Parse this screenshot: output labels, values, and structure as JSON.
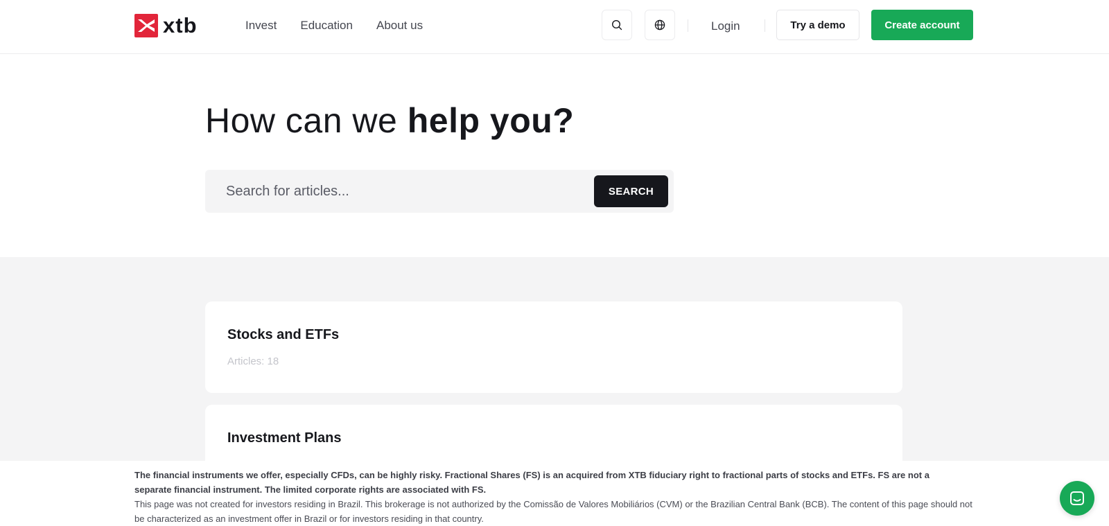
{
  "header": {
    "logo_text": "xtb",
    "nav": [
      {
        "label": "Invest"
      },
      {
        "label": "Education"
      },
      {
        "label": "About us"
      }
    ],
    "search_icon": "search-icon",
    "globe_icon": "globe-icon",
    "login_label": "Login",
    "demo_label": "Try a demo",
    "create_label": "Create account",
    "brand_red": "#e2253a",
    "brand_green": "#18a957"
  },
  "hero": {
    "title_light": "How can we ",
    "title_bold": "help you?",
    "search_placeholder": "Search for articles...",
    "search_button": "SEARCH"
  },
  "categories": [
    {
      "title": "Stocks and ETFs",
      "meta": "Articles: 18"
    },
    {
      "title": "Investment Plans"
    }
  ],
  "disclaimer": {
    "bold": "The financial instruments we offer, especially CFDs, can be highly risky. Fractional Shares (FS) is an acquired from XTB fiduciary right to fractional parts of stocks and ETFs. FS are not a separate financial instrument. The limited corporate rights are associated with FS.",
    "normal": "This page was not created for investors residing in Brazil. This brokerage is not authorized by the Comissão de Valores Mobiliários (CVM) or the Brazilian Central Bank (BCB). The content of this page should not be characterized as an investment offer in Brazil or for investors residing in that country."
  },
  "chat_icon": "chat-icon"
}
